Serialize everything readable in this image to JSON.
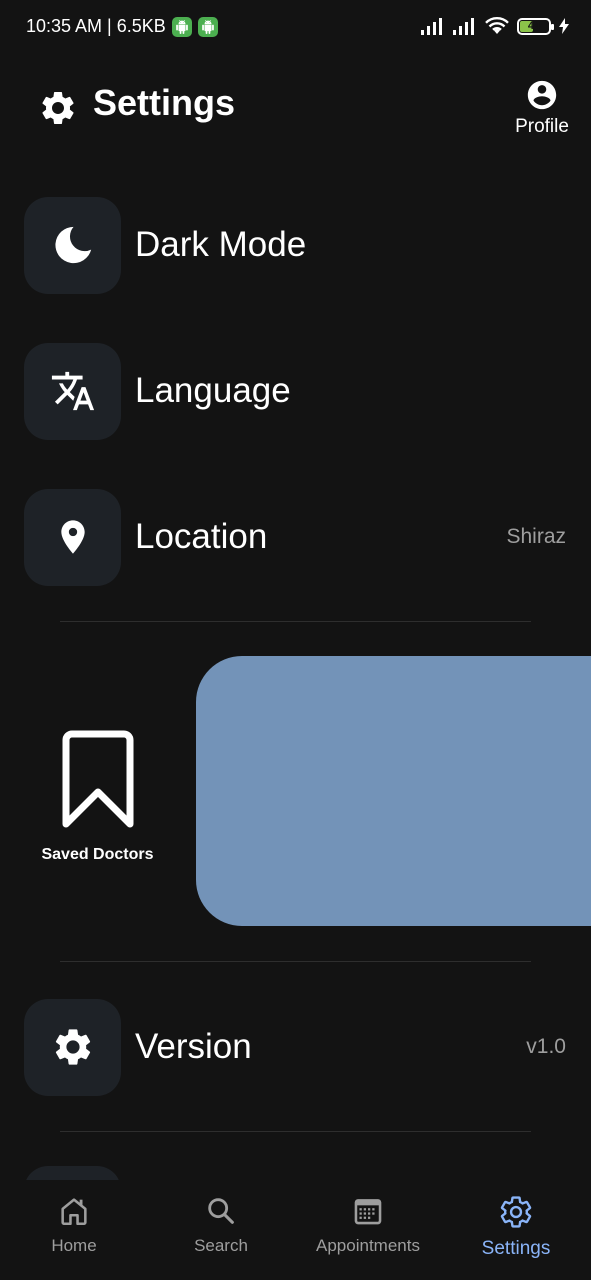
{
  "status_bar": {
    "time_info": "10:35 AM | 6.5KB",
    "battery_level": "44"
  },
  "header": {
    "title": "Settings",
    "profile_label": "Profile"
  },
  "settings": {
    "dark_mode": {
      "label": "Dark Mode",
      "icon": "moon-icon"
    },
    "language": {
      "label": "Language",
      "icon": "translate-icon"
    },
    "location": {
      "label": "Location",
      "value": "Shiraz",
      "icon": "location-pin-icon"
    },
    "version": {
      "label": "Version",
      "value": "v1.0",
      "icon": "gear-icon"
    }
  },
  "saved_doctors": {
    "label": "Saved Doctors",
    "icon": "bookmark-icon",
    "panel_color": "#7393b8"
  },
  "bottom_nav": {
    "items": [
      {
        "label": "Home",
        "icon": "home-icon"
      },
      {
        "label": "Search",
        "icon": "search-icon"
      },
      {
        "label": "Appointments",
        "icon": "calendar-icon"
      },
      {
        "label": "Settings",
        "icon": "gear-icon"
      }
    ],
    "active_index": 3,
    "active_color": "#8ab4f8"
  }
}
